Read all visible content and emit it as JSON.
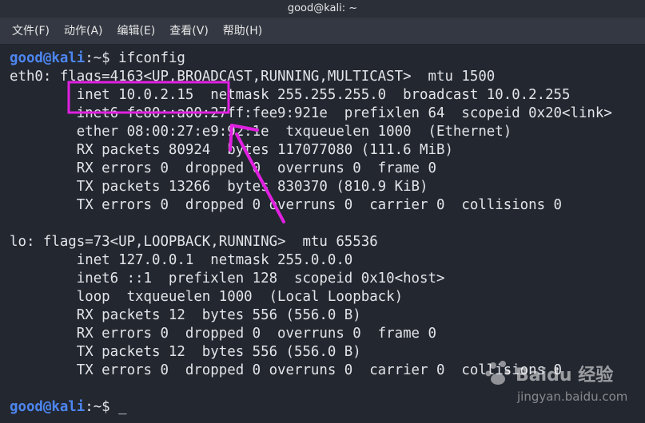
{
  "window": {
    "title": "good@kali: ~"
  },
  "menu": [
    {
      "label": "文件(F)"
    },
    {
      "label": "动作(A)"
    },
    {
      "label": "编辑(E)"
    },
    {
      "label": "查看(V)"
    },
    {
      "label": "帮助(H)"
    }
  ],
  "prompt": {
    "user": "good@kali",
    "path": ":~$ "
  },
  "command": "ifconfig",
  "output": [
    "eth0: flags=4163<UP,BROADCAST,RUNNING,MULTICAST>  mtu 1500",
    "        inet 10.0.2.15  netmask 255.255.255.0  broadcast 10.0.2.255",
    "        inet6 fe80::a00:27ff:fee9:921e  prefixlen 64  scopeid 0x20<link>",
    "        ether 08:00:27:e9:92:1e  txqueuelen 1000  (Ethernet)",
    "        RX packets 80924  bytes 117077080 (111.6 MiB)",
    "        RX errors 0  dropped 0  overruns 0  frame 0",
    "        TX packets 13266  bytes 830370 (810.9 KiB)",
    "        TX errors 0  dropped 0 overruns 0  carrier 0  collisions 0",
    "",
    "lo: flags=73<UP,LOOPBACK,RUNNING>  mtu 65536",
    "        inet 127.0.0.1  netmask 255.0.0.0",
    "        inet6 ::1  prefixlen 128  scopeid 0x10<host>",
    "        loop  txqueuelen 1000  (Local Loopback)",
    "        RX packets 12  bytes 556 (556.0 B)",
    "        RX errors 0  dropped 0  overruns 0  frame 0",
    "        TX packets 12  bytes 556 (556.0 B)",
    "        TX errors 0  dropped 0 overruns 0  carrier 0  collisions 0"
  ],
  "cursor": "_",
  "watermark": {
    "brand": "Baidu 经验",
    "url": "jingyan.baidu.com"
  },
  "colors": {
    "prompt_user": "#4d86f0",
    "annotation": "#e020e0",
    "background": "#232730"
  }
}
